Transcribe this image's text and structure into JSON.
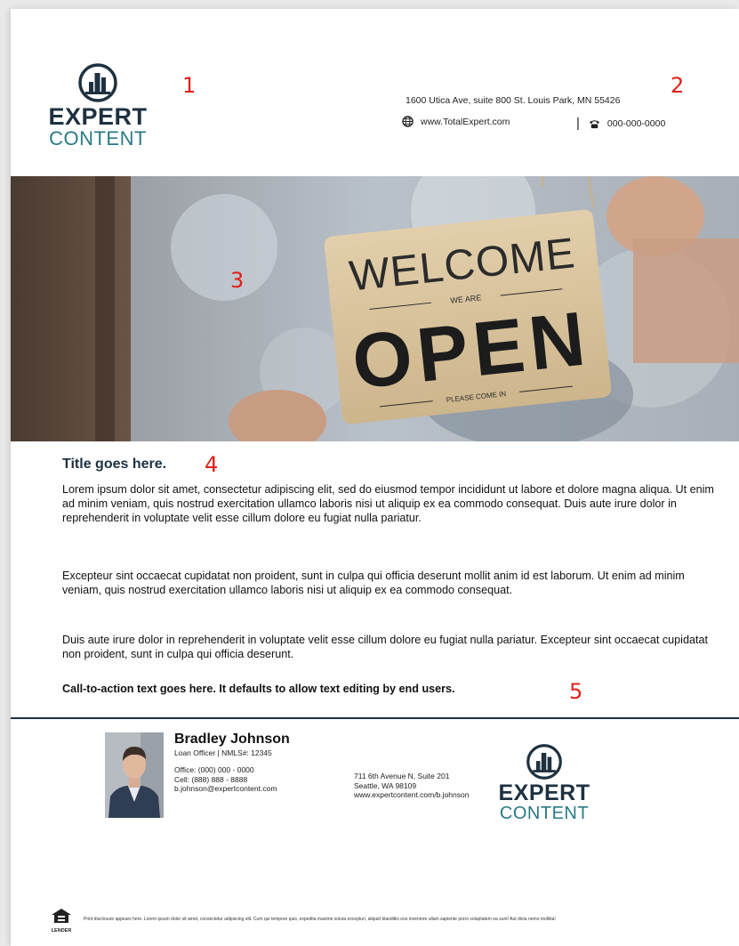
{
  "header": {
    "logo": {
      "word1": "EXPERT",
      "word2": "CONTENT"
    },
    "address": "1600 Utica Ave, suite 800 St. Louis Park, MN 55426",
    "website": "www.TotalExpert.com",
    "separator": "|",
    "phone": "000-000-0000",
    "icons": {
      "website": "globe-icon",
      "phone": "telephone-icon"
    }
  },
  "callouts": [
    "1",
    "2",
    "3",
    "4",
    "5"
  ],
  "hero": {
    "sign": {
      "line1": "WELCOME",
      "line2": "WE ARE",
      "line3": "OPEN",
      "line4": "PLEASE COME IN"
    }
  },
  "body": {
    "title": "Title goes here.",
    "paragraphs": [
      "Lorem ipsum dolor sit amet, consectetur adipiscing elit, sed do eiusmod tempor incididunt ut labore et dolore magna aliqua. Ut enim ad minim veniam, quis nostrud exercitation ullamco laboris nisi ut aliquip ex ea commodo consequat. Duis aute irure dolor in reprehenderit in voluptate velit esse cillum dolore eu fugiat nulla pariatur.",
      "Excepteur sint occaecat cupidatat non proident, sunt in culpa qui officia deserunt mollit anim id est laborum. Ut enim ad minim veniam, quis nostrud exercitation ullamco laboris nisi ut aliquip ex ea commodo consequat.",
      "Duis aute irure dolor in reprehenderit in voluptate velit esse cillum dolore eu fugiat nulla pariatur. Excepteur sint occaecat cupidatat non proident, sunt in culpa qui officia deserunt."
    ],
    "cta": "Call-to-action text goes here. It defaults to allow text editing by end users."
  },
  "footer": {
    "agent": {
      "name": "Bradley Johnson",
      "role": "Loan Officer | NMLS#: 12345",
      "office_phone": "Office: (000) 000 - 0000",
      "cell_phone": "Cell: (888) 888 - 8888",
      "email": "b.johnson@expertcontent.com"
    },
    "office": {
      "street": "711 6th Avenue N, Suite 201",
      "city": "Seattle, WA 98109",
      "url": "www.expertcontent.com/b.johnson"
    },
    "logo": {
      "word1": "EXPERT",
      "word2": "CONTENT"
    },
    "equal_housing": {
      "label": "LENDER"
    },
    "disclosure": "Print disclosure appears here. Lorem ipsum dolor sit amet, consectetur adipiscing elit. Cum qui tempore quis, expedita maxime soluta excepturi, aliquid blanditiis eos inventore ullam sapiente porro voluptatem ea sunt! Aut dicta nemo mollitia!"
  },
  "colors": {
    "brand_navy": "#1e3140",
    "brand_teal": "#2a7a86",
    "callout_red": "#e0201b"
  }
}
